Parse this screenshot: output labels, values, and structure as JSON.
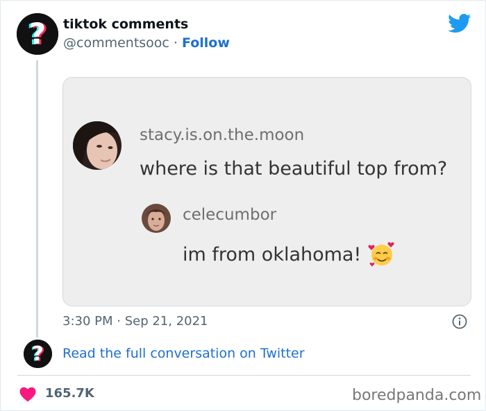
{
  "tweet": {
    "author_name": "tiktok comments",
    "handle": "@commentsooc",
    "separator": "·",
    "follow_label": "Follow",
    "timestamp": "3:30 PM · Sep 21, 2021",
    "read_more_label": "Read the full conversation on Twitter",
    "like_count": "165.7K"
  },
  "media": {
    "comment1": {
      "username": "stacy.is.on.the.moon",
      "text": "where is that beautiful top from?"
    },
    "comment2": {
      "username": "celecumbor",
      "text": "im from oklahoma!"
    }
  },
  "icons": {
    "brand": "twitter-bird-icon",
    "info": "info-icon",
    "like": "heart-icon",
    "avatar": "question-mark-avatar"
  },
  "colors": {
    "twitter_blue": "#1d9bf0",
    "link_blue": "#1d6fd0",
    "heart": "#f91880",
    "muted": "#536471"
  },
  "watermark": "boredpanda.com"
}
